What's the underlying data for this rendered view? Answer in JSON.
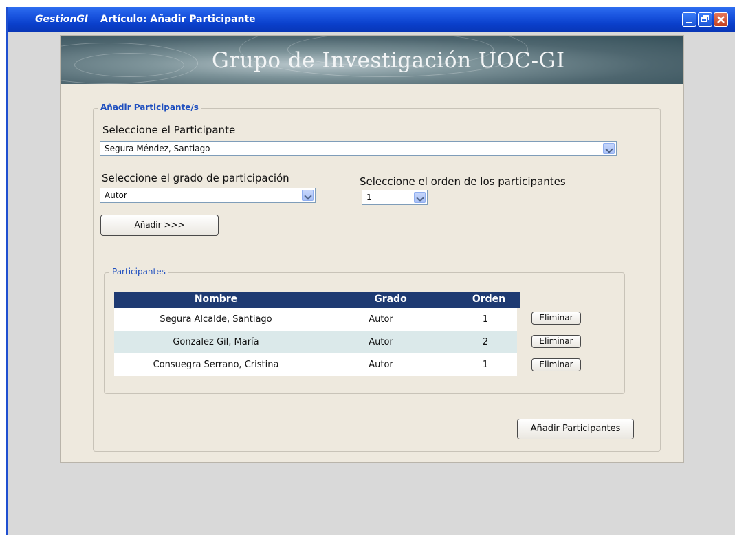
{
  "window": {
    "app": "GestionGI",
    "title": "Artículo: Añadir Participante"
  },
  "banner": {
    "title": "Grupo de Investigación UOC-GI"
  },
  "form": {
    "section_legend": "Añadir Participante/s",
    "participant_label": "Seleccione el Participante",
    "participant_value": "Segura Méndez, Santiago",
    "grade_label": "Seleccione el grado de participación",
    "grade_value": "Autor",
    "order_label": "Seleccione el orden de los participantes",
    "order_value": "1",
    "add_button": "Añadir >>>"
  },
  "participants": {
    "legend": "Participantes",
    "columns": [
      "Nombre",
      "Grado",
      "Orden"
    ],
    "rows": [
      {
        "nombre": "Segura Alcalde, Santiago",
        "grado": "Autor",
        "orden": "1",
        "action": "Eliminar"
      },
      {
        "nombre": "Gonzalez Gil, María",
        "grado": "Autor",
        "orden": "2",
        "action": "Eliminar"
      },
      {
        "nombre": "Consuegra Serrano, Cristina",
        "grado": "Autor",
        "orden": "1",
        "action": "Eliminar"
      }
    ]
  },
  "footer": {
    "submit_button": "Añadir Participantes"
  },
  "colors": {
    "titlebar": "#0a3fcb",
    "table_header": "#1e3a72",
    "alt_row": "#dbe9ea",
    "panel": "#eee9de"
  }
}
